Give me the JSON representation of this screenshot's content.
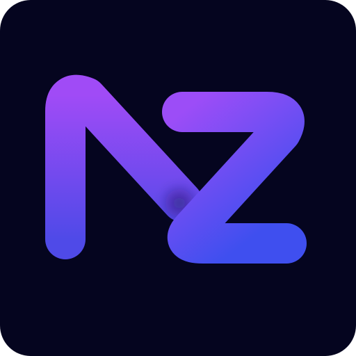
{
  "icon": {
    "name": "nz-logo-app-icon",
    "logo_text": "NZ",
    "colors": {
      "background": "#05051f",
      "gradient_top": "#a04bf6",
      "gradient_bottom": "#4f4ae8",
      "gradient_end": "#3f4fef"
    }
  }
}
